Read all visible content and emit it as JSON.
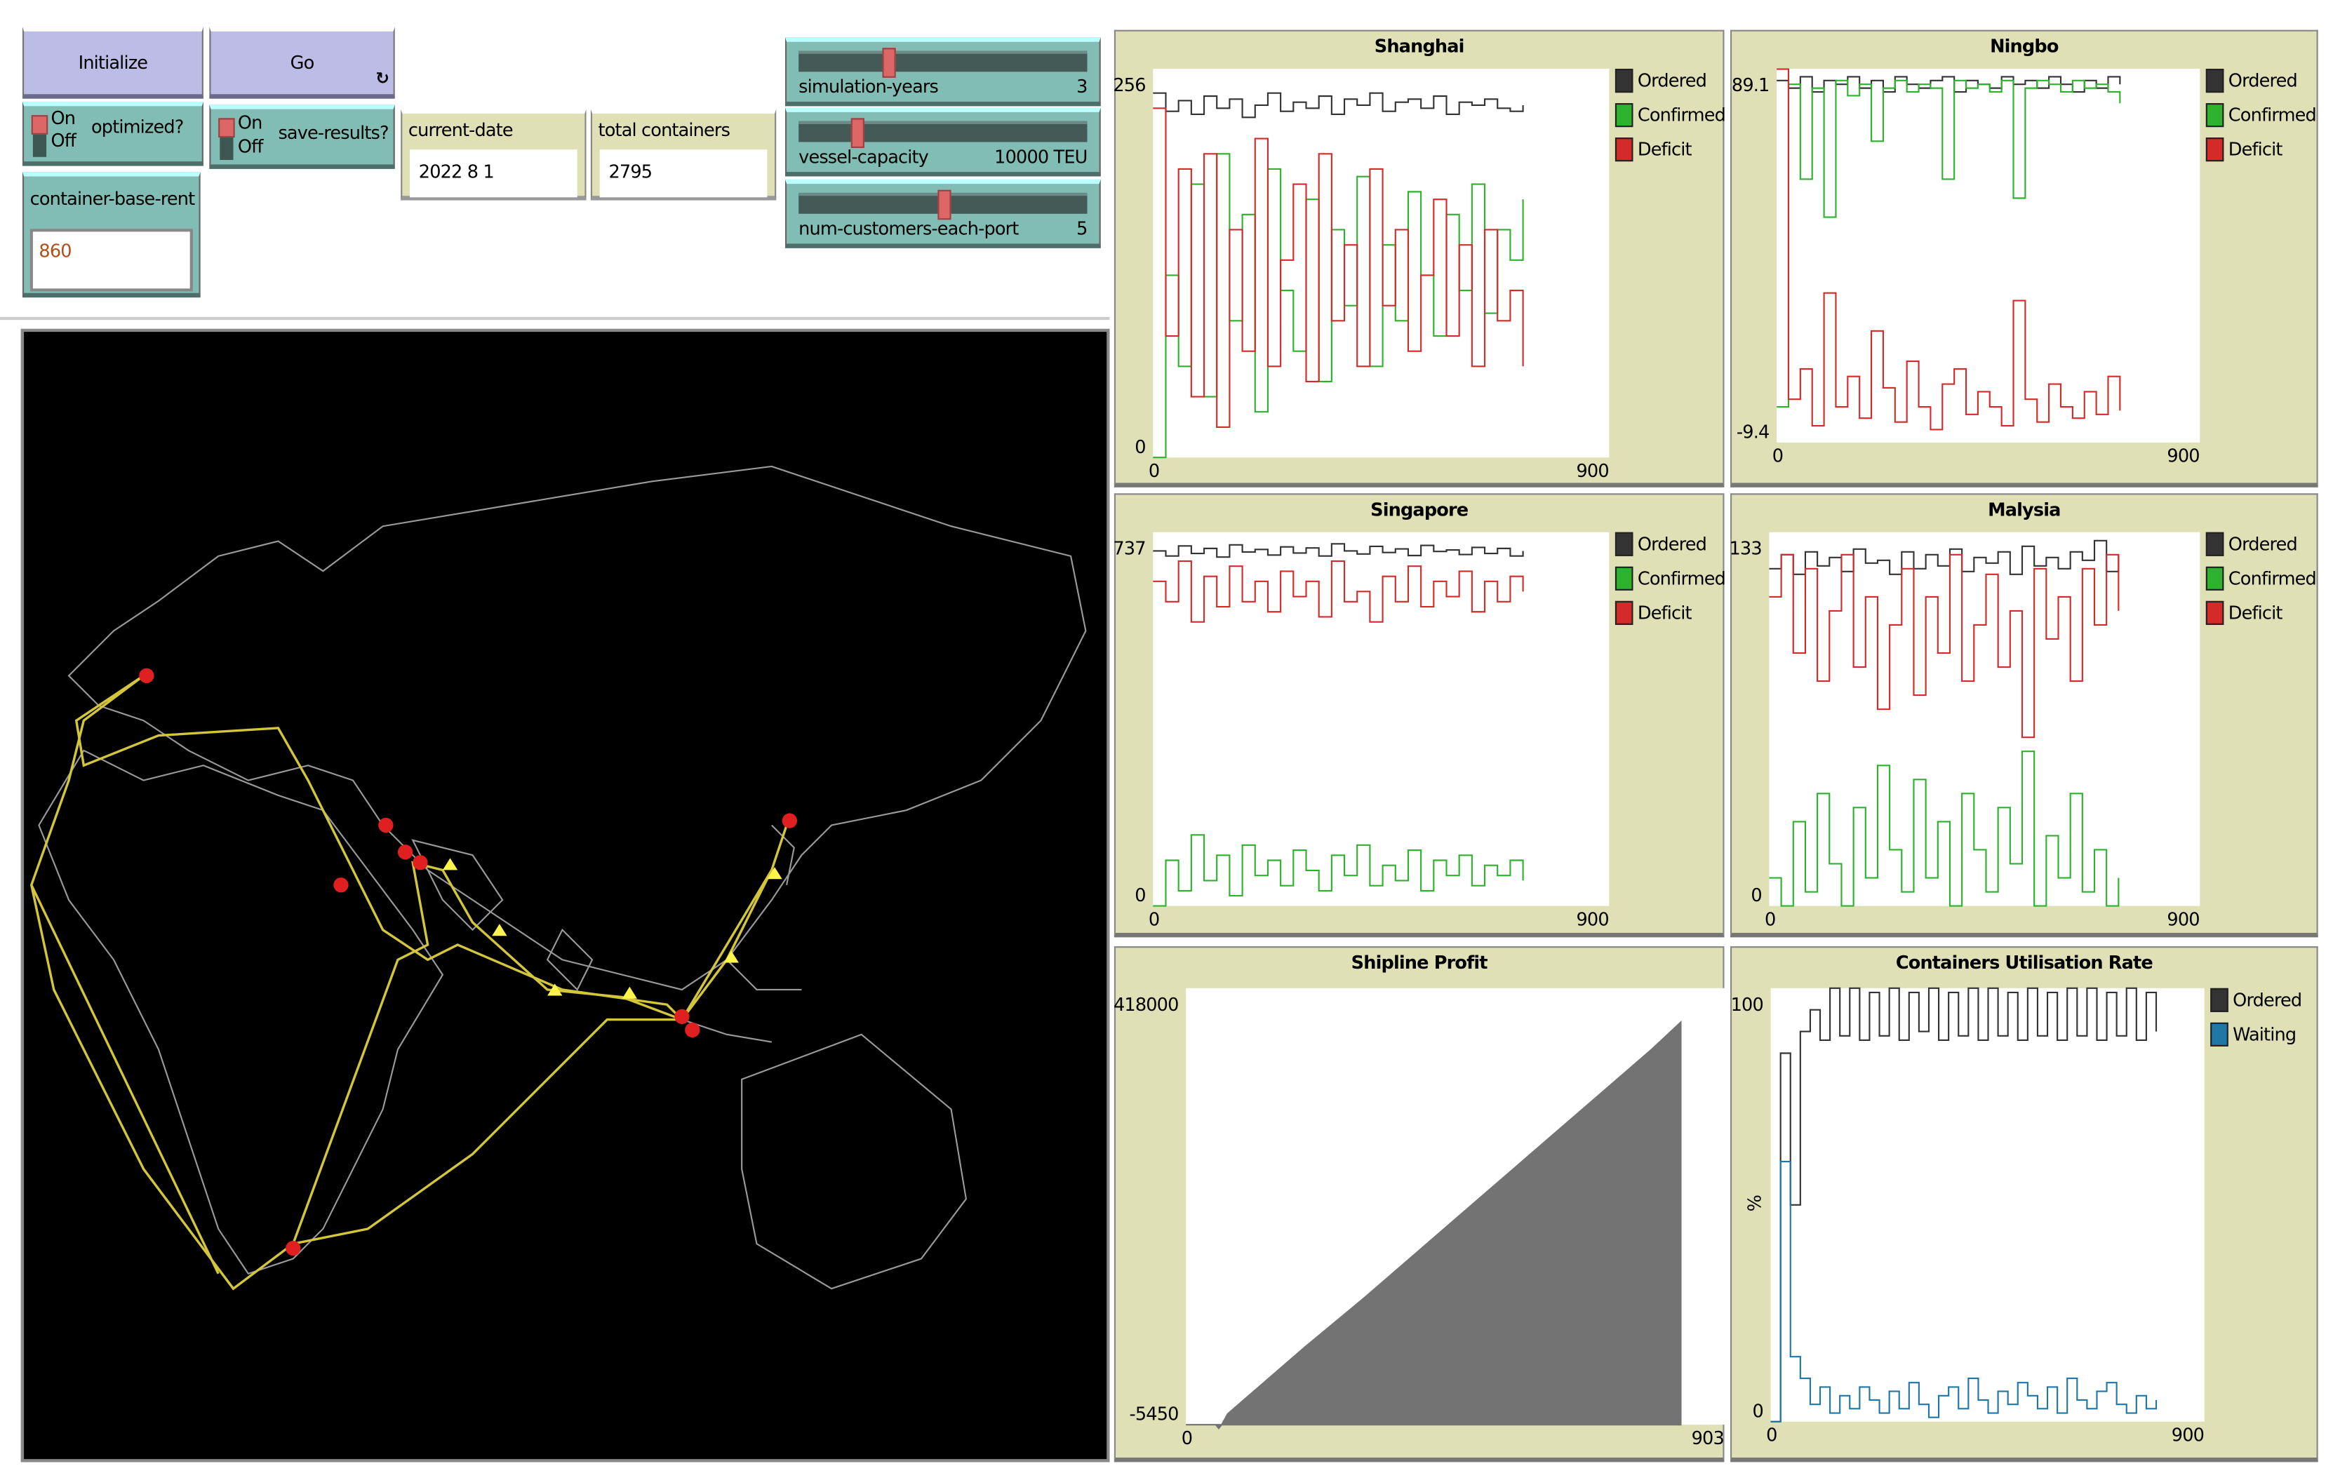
{
  "controls": {
    "initialize": "Initialize",
    "go": "Go",
    "go_icon": "forever-icon",
    "optimized": {
      "on": "On",
      "off": "Off",
      "label": "optimized?",
      "state": "on"
    },
    "save_results": {
      "on": "On",
      "off": "Off",
      "label": "save-results?",
      "state": "on"
    },
    "container_base_rent": {
      "label": "container-base-rent",
      "value": "860"
    },
    "current_date": {
      "label": "current-date",
      "value": "2022 8 1"
    },
    "total_containers": {
      "label": "total containers",
      "value": "2795"
    },
    "sliders": [
      {
        "label": "simulation-years",
        "value": "3",
        "fraction": 0.3
      },
      {
        "label": "vessel-capacity",
        "value": "10000 TEU",
        "fraction": 0.19
      },
      {
        "label": "num-customers-each-port",
        "value": "5",
        "fraction": 0.5
      }
    ]
  },
  "colors": {
    "ordered": "#333333",
    "confirmed": "#2db22d",
    "deficit": "#d42a2a",
    "waiting": "#1f77a8",
    "profit": "#737373",
    "route": "#d4c63a",
    "port": "#e02020"
  },
  "chart_data": [
    {
      "id": "shanghai",
      "type": "line",
      "title": "Shanghai",
      "xlim": [
        0,
        900
      ],
      "ylim": [
        0,
        256
      ],
      "xticks": [
        "0",
        "900"
      ],
      "yticks": [
        "0",
        "256"
      ],
      "legend": [
        "Ordered",
        "Confirmed",
        "Deficit"
      ],
      "x_end": 730,
      "series": [
        {
          "name": "Ordered",
          "values": [
            240,
            228,
            235,
            226,
            238,
            230,
            236,
            224,
            232,
            240,
            228,
            234,
            230,
            238,
            226,
            236,
            232,
            240,
            228,
            234,
            236,
            230,
            238,
            226,
            234,
            232,
            236,
            230,
            228,
            232
          ]
        },
        {
          "name": "Confirmed",
          "values": [
            0,
            120,
            60,
            180,
            40,
            200,
            90,
            160,
            30,
            190,
            110,
            70,
            170,
            50,
            150,
            100,
            185,
            60,
            140,
            90,
            175,
            120,
            80,
            160,
            110,
            180,
            95,
            150,
            130,
            170
          ]
        },
        {
          "name": "Deficit",
          "values": [
            230,
            80,
            190,
            40,
            200,
            20,
            150,
            70,
            210,
            60,
            130,
            180,
            50,
            200,
            90,
            140,
            60,
            190,
            100,
            150,
            70,
            120,
            170,
            80,
            140,
            60,
            150,
            90,
            110,
            60
          ]
        }
      ]
    },
    {
      "id": "ningbo",
      "type": "line",
      "title": "Ningbo",
      "xlim": [
        0,
        900
      ],
      "ylim": [
        -9.4,
        89.1
      ],
      "xticks": [
        "0",
        "900"
      ],
      "yticks": [
        "-9.4",
        "89.1"
      ],
      "legend": [
        "Ordered",
        "Confirmed",
        "Deficit"
      ],
      "x_end": 730,
      "series": [
        {
          "name": "Ordered",
          "values": [
            86,
            84,
            87,
            83,
            86,
            85,
            87,
            84,
            86,
            83,
            87,
            85,
            84,
            86,
            87,
            83,
            86,
            85,
            84,
            87,
            85,
            86,
            84,
            87,
            85,
            83,
            86,
            84,
            87,
            85
          ]
        },
        {
          "name": "Confirmed",
          "values": [
            0,
            85,
            60,
            84,
            50,
            86,
            82,
            85,
            70,
            84,
            86,
            83,
            85,
            84,
            60,
            86,
            84,
            85,
            83,
            86,
            55,
            84,
            86,
            85,
            83,
            86,
            84,
            85,
            83,
            80
          ]
        },
        {
          "name": "Deficit",
          "values": [
            89,
            2,
            10,
            -5,
            30,
            0,
            8,
            -3,
            20,
            5,
            -4,
            12,
            0,
            -6,
            6,
            10,
            -2,
            4,
            0,
            -5,
            28,
            2,
            -4,
            6,
            0,
            -3,
            4,
            -2,
            8,
            -1
          ]
        }
      ]
    },
    {
      "id": "singapore",
      "type": "line",
      "title": "Singapore",
      "xlim": [
        0,
        900
      ],
      "ylim": [
        0,
        737
      ],
      "xticks": [
        "0",
        "900"
      ],
      "yticks": [
        "0",
        "737"
      ],
      "legend": [
        "Ordered",
        "Confirmed",
        "Deficit"
      ],
      "x_end": 730,
      "series": [
        {
          "name": "Ordered",
          "values": [
            700,
            690,
            710,
            695,
            705,
            688,
            712,
            698,
            703,
            692,
            708,
            696,
            706,
            690,
            714,
            700,
            694,
            709,
            697,
            704,
            691,
            711,
            699,
            702,
            693,
            707,
            695,
            705,
            690,
            700
          ]
        },
        {
          "name": "Confirmed",
          "values": [
            0,
            90,
            30,
            140,
            50,
            100,
            20,
            120,
            60,
            90,
            40,
            110,
            70,
            30,
            100,
            60,
            120,
            40,
            80,
            50,
            110,
            30,
            90,
            60,
            100,
            40,
            80,
            60,
            90,
            50
          ]
        },
        {
          "name": "Deficit",
          "values": [
            640,
            600,
            680,
            560,
            650,
            590,
            670,
            600,
            640,
            580,
            660,
            610,
            640,
            570,
            680,
            600,
            620,
            560,
            650,
            600,
            670,
            590,
            640,
            610,
            660,
            580,
            640,
            600,
            650,
            620
          ]
        }
      ]
    },
    {
      "id": "malysia",
      "type": "line",
      "title": "Malysia",
      "xlim": [
        0,
        900
      ],
      "ylim": [
        0,
        133
      ],
      "xticks": [
        "0",
        "900"
      ],
      "yticks": [
        "0",
        "133"
      ],
      "legend": [
        "Ordered",
        "Confirmed",
        "Deficit"
      ],
      "x_end": 730,
      "series": [
        {
          "name": "Ordered",
          "values": [
            120,
            125,
            118,
            126,
            121,
            124,
            119,
            127,
            122,
            123,
            118,
            126,
            120,
            125,
            121,
            127,
            119,
            124,
            122,
            126,
            118,
            128,
            121,
            124,
            120,
            126,
            123,
            130,
            119,
            125
          ]
        },
        {
          "name": "Confirmed",
          "values": [
            10,
            0,
            30,
            5,
            40,
            15,
            0,
            35,
            10,
            50,
            20,
            5,
            45,
            10,
            30,
            0,
            40,
            20,
            5,
            35,
            15,
            55,
            0,
            25,
            10,
            40,
            5,
            20,
            0,
            10
          ]
        },
        {
          "name": "Deficit",
          "values": [
            110,
            125,
            90,
            120,
            80,
            105,
            125,
            85,
            110,
            70,
            100,
            120,
            75,
            110,
            90,
            125,
            80,
            100,
            118,
            85,
            105,
            60,
            120,
            95,
            110,
            80,
            120,
            100,
            125,
            105
          ]
        }
      ]
    },
    {
      "id": "shipline-profit",
      "type": "area",
      "title": "Shipline Profit",
      "xlim": [
        0,
        903
      ],
      "ylim": [
        -5450,
        418000
      ],
      "xticks": [
        "0",
        "903"
      ],
      "yticks": [
        "-5450",
        "418000"
      ],
      "series": [
        {
          "name": "Profit",
          "x": [
            0,
            50,
            55,
            60,
            70,
            100,
            200,
            300,
            400,
            500,
            600,
            700,
            780,
            830
          ],
          "values": [
            -5450,
            -5450,
            -9000,
            -5450,
            5000,
            20000,
            70000,
            118000,
            168000,
            218000,
            268000,
            318000,
            358000,
            385000
          ]
        }
      ]
    },
    {
      "id": "containers-utilisation",
      "type": "line",
      "title": "Containers Utilisation Rate",
      "xlim": [
        0,
        900
      ],
      "ylim": [
        0,
        100
      ],
      "xticks": [
        "0",
        "900"
      ],
      "yticks": [
        "0",
        "100"
      ],
      "ylabel": "%",
      "legend": [
        "Ordered",
        "Waiting"
      ],
      "x_end": 800,
      "series": [
        {
          "name": "Ordered",
          "values": [
            0,
            85,
            50,
            90,
            95,
            88,
            100,
            89,
            100,
            88,
            99,
            89,
            100,
            88,
            99,
            90,
            100,
            88,
            99,
            89,
            100,
            88,
            100,
            89,
            99,
            88,
            100,
            89,
            99,
            88,
            100,
            89,
            100,
            88,
            99,
            89,
            100,
            88,
            99,
            90
          ]
        },
        {
          "name": "Waiting",
          "values": [
            0,
            60,
            15,
            10,
            4,
            8,
            2,
            6,
            3,
            8,
            5,
            2,
            7,
            3,
            9,
            4,
            1,
            6,
            8,
            3,
            10,
            5,
            2,
            7,
            4,
            9,
            6,
            3,
            8,
            2,
            10,
            5,
            3,
            7,
            9,
            4,
            2,
            6,
            3,
            5
          ]
        }
      ]
    }
  ]
}
